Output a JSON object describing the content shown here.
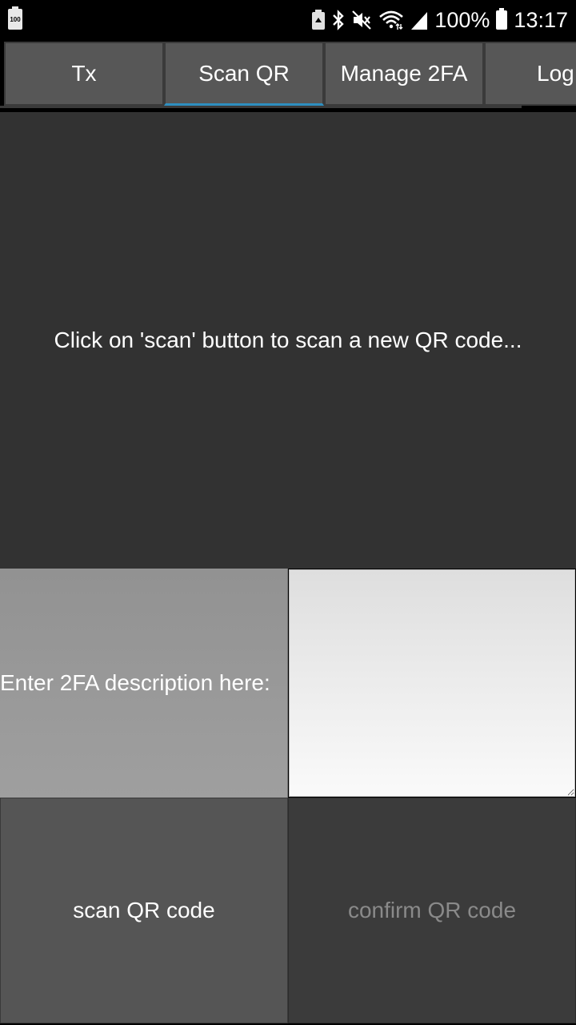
{
  "status_bar": {
    "left_battery_label": "100",
    "battery_percent": "100%",
    "time": "13:17",
    "icons": [
      "battery-small-icon",
      "saver-icon",
      "bluetooth-icon",
      "mute-icon",
      "wifi-icon",
      "signal-icon",
      "battery-icon"
    ]
  },
  "tabs": [
    {
      "label": "Tx",
      "active": false
    },
    {
      "label": "Scan QR",
      "active": true
    },
    {
      "label": "Manage 2FA",
      "active": false
    },
    {
      "label": "Log",
      "active": false
    }
  ],
  "scan": {
    "message": "Click on 'scan' button to scan a new QR code..."
  },
  "description": {
    "label": "Enter 2FA description here:",
    "value": ""
  },
  "buttons": {
    "scan_label": "scan QR code",
    "confirm_label": "confirm QR code"
  },
  "colors": {
    "background": "#323232",
    "tab": "#575757",
    "active_tab_indicator": "#2e8fc0",
    "disabled_text": "#8a8a8a"
  }
}
